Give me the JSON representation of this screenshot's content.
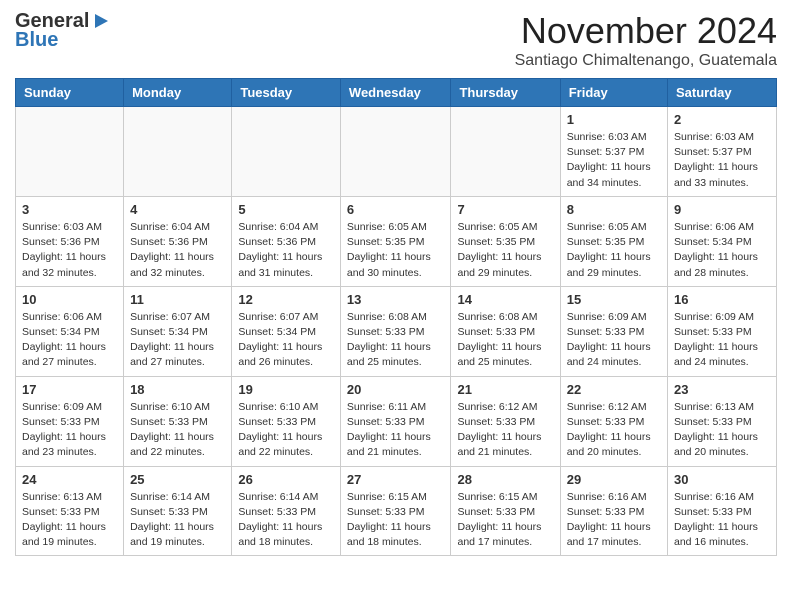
{
  "header": {
    "logo_general": "General",
    "logo_blue": "Blue",
    "month_title": "November 2024",
    "location": "Santiago Chimaltenango, Guatemala"
  },
  "weekdays": [
    "Sunday",
    "Monday",
    "Tuesday",
    "Wednesday",
    "Thursday",
    "Friday",
    "Saturday"
  ],
  "weeks": [
    [
      {
        "day": "",
        "info": ""
      },
      {
        "day": "",
        "info": ""
      },
      {
        "day": "",
        "info": ""
      },
      {
        "day": "",
        "info": ""
      },
      {
        "day": "",
        "info": ""
      },
      {
        "day": "1",
        "info": "Sunrise: 6:03 AM\nSunset: 5:37 PM\nDaylight: 11 hours and 34 minutes."
      },
      {
        "day": "2",
        "info": "Sunrise: 6:03 AM\nSunset: 5:37 PM\nDaylight: 11 hours and 33 minutes."
      }
    ],
    [
      {
        "day": "3",
        "info": "Sunrise: 6:03 AM\nSunset: 5:36 PM\nDaylight: 11 hours and 32 minutes."
      },
      {
        "day": "4",
        "info": "Sunrise: 6:04 AM\nSunset: 5:36 PM\nDaylight: 11 hours and 32 minutes."
      },
      {
        "day": "5",
        "info": "Sunrise: 6:04 AM\nSunset: 5:36 PM\nDaylight: 11 hours and 31 minutes."
      },
      {
        "day": "6",
        "info": "Sunrise: 6:05 AM\nSunset: 5:35 PM\nDaylight: 11 hours and 30 minutes."
      },
      {
        "day": "7",
        "info": "Sunrise: 6:05 AM\nSunset: 5:35 PM\nDaylight: 11 hours and 29 minutes."
      },
      {
        "day": "8",
        "info": "Sunrise: 6:05 AM\nSunset: 5:35 PM\nDaylight: 11 hours and 29 minutes."
      },
      {
        "day": "9",
        "info": "Sunrise: 6:06 AM\nSunset: 5:34 PM\nDaylight: 11 hours and 28 minutes."
      }
    ],
    [
      {
        "day": "10",
        "info": "Sunrise: 6:06 AM\nSunset: 5:34 PM\nDaylight: 11 hours and 27 minutes."
      },
      {
        "day": "11",
        "info": "Sunrise: 6:07 AM\nSunset: 5:34 PM\nDaylight: 11 hours and 27 minutes."
      },
      {
        "day": "12",
        "info": "Sunrise: 6:07 AM\nSunset: 5:34 PM\nDaylight: 11 hours and 26 minutes."
      },
      {
        "day": "13",
        "info": "Sunrise: 6:08 AM\nSunset: 5:33 PM\nDaylight: 11 hours and 25 minutes."
      },
      {
        "day": "14",
        "info": "Sunrise: 6:08 AM\nSunset: 5:33 PM\nDaylight: 11 hours and 25 minutes."
      },
      {
        "day": "15",
        "info": "Sunrise: 6:09 AM\nSunset: 5:33 PM\nDaylight: 11 hours and 24 minutes."
      },
      {
        "day": "16",
        "info": "Sunrise: 6:09 AM\nSunset: 5:33 PM\nDaylight: 11 hours and 24 minutes."
      }
    ],
    [
      {
        "day": "17",
        "info": "Sunrise: 6:09 AM\nSunset: 5:33 PM\nDaylight: 11 hours and 23 minutes."
      },
      {
        "day": "18",
        "info": "Sunrise: 6:10 AM\nSunset: 5:33 PM\nDaylight: 11 hours and 22 minutes."
      },
      {
        "day": "19",
        "info": "Sunrise: 6:10 AM\nSunset: 5:33 PM\nDaylight: 11 hours and 22 minutes."
      },
      {
        "day": "20",
        "info": "Sunrise: 6:11 AM\nSunset: 5:33 PM\nDaylight: 11 hours and 21 minutes."
      },
      {
        "day": "21",
        "info": "Sunrise: 6:12 AM\nSunset: 5:33 PM\nDaylight: 11 hours and 21 minutes."
      },
      {
        "day": "22",
        "info": "Sunrise: 6:12 AM\nSunset: 5:33 PM\nDaylight: 11 hours and 20 minutes."
      },
      {
        "day": "23",
        "info": "Sunrise: 6:13 AM\nSunset: 5:33 PM\nDaylight: 11 hours and 20 minutes."
      }
    ],
    [
      {
        "day": "24",
        "info": "Sunrise: 6:13 AM\nSunset: 5:33 PM\nDaylight: 11 hours and 19 minutes."
      },
      {
        "day": "25",
        "info": "Sunrise: 6:14 AM\nSunset: 5:33 PM\nDaylight: 11 hours and 19 minutes."
      },
      {
        "day": "26",
        "info": "Sunrise: 6:14 AM\nSunset: 5:33 PM\nDaylight: 11 hours and 18 minutes."
      },
      {
        "day": "27",
        "info": "Sunrise: 6:15 AM\nSunset: 5:33 PM\nDaylight: 11 hours and 18 minutes."
      },
      {
        "day": "28",
        "info": "Sunrise: 6:15 AM\nSunset: 5:33 PM\nDaylight: 11 hours and 17 minutes."
      },
      {
        "day": "29",
        "info": "Sunrise: 6:16 AM\nSunset: 5:33 PM\nDaylight: 11 hours and 17 minutes."
      },
      {
        "day": "30",
        "info": "Sunrise: 6:16 AM\nSunset: 5:33 PM\nDaylight: 11 hours and 16 minutes."
      }
    ]
  ]
}
